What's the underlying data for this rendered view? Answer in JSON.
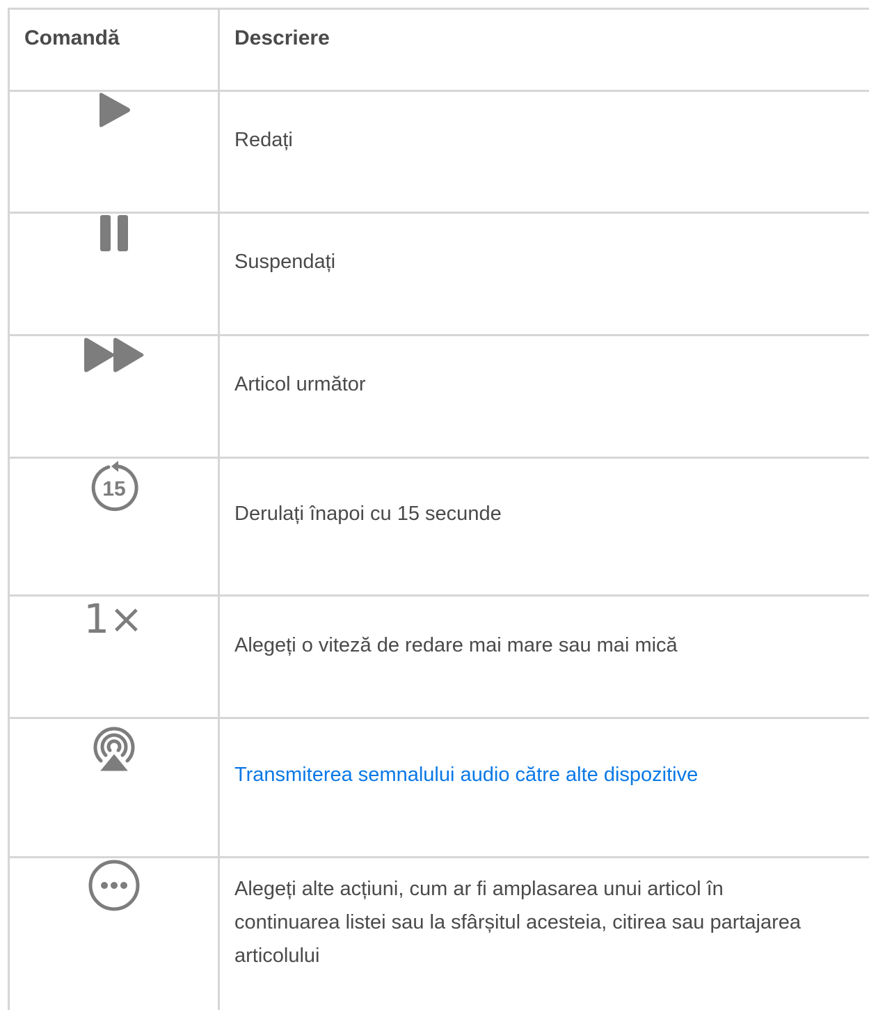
{
  "table": {
    "header": {
      "command": "Comandă",
      "description": "Descriere"
    },
    "rows": [
      {
        "icon": "play-icon",
        "description": "Redați"
      },
      {
        "icon": "pause-icon",
        "description": "Suspendați"
      },
      {
        "icon": "fast-forward-icon",
        "description": "Articol următor"
      },
      {
        "icon": "skip-back-15-icon",
        "icon_label": "15",
        "description": "Derulați înapoi cu 15 secunde"
      },
      {
        "icon": "playback-speed-icon",
        "icon_label": "1×",
        "description": "Alegeți o viteză de redare mai mare sau mai mică"
      },
      {
        "icon": "airplay-audio-icon",
        "description": "Transmiterea semnalului audio către alte dispozitive",
        "is_link": true,
        "link_color": "#0a78e6"
      },
      {
        "icon": "more-options-icon",
        "description": "Alegeți alte acțiuni, cum ar fi amplasarea unui articol în continuarea listei sau la sfârșitul acesteia, citirea sau partajarea articolului"
      }
    ]
  },
  "colors": {
    "icon": "#7d7d7d",
    "border": "#d6d6d6",
    "text": "#4a4a4a",
    "link": "#0a78e6"
  }
}
